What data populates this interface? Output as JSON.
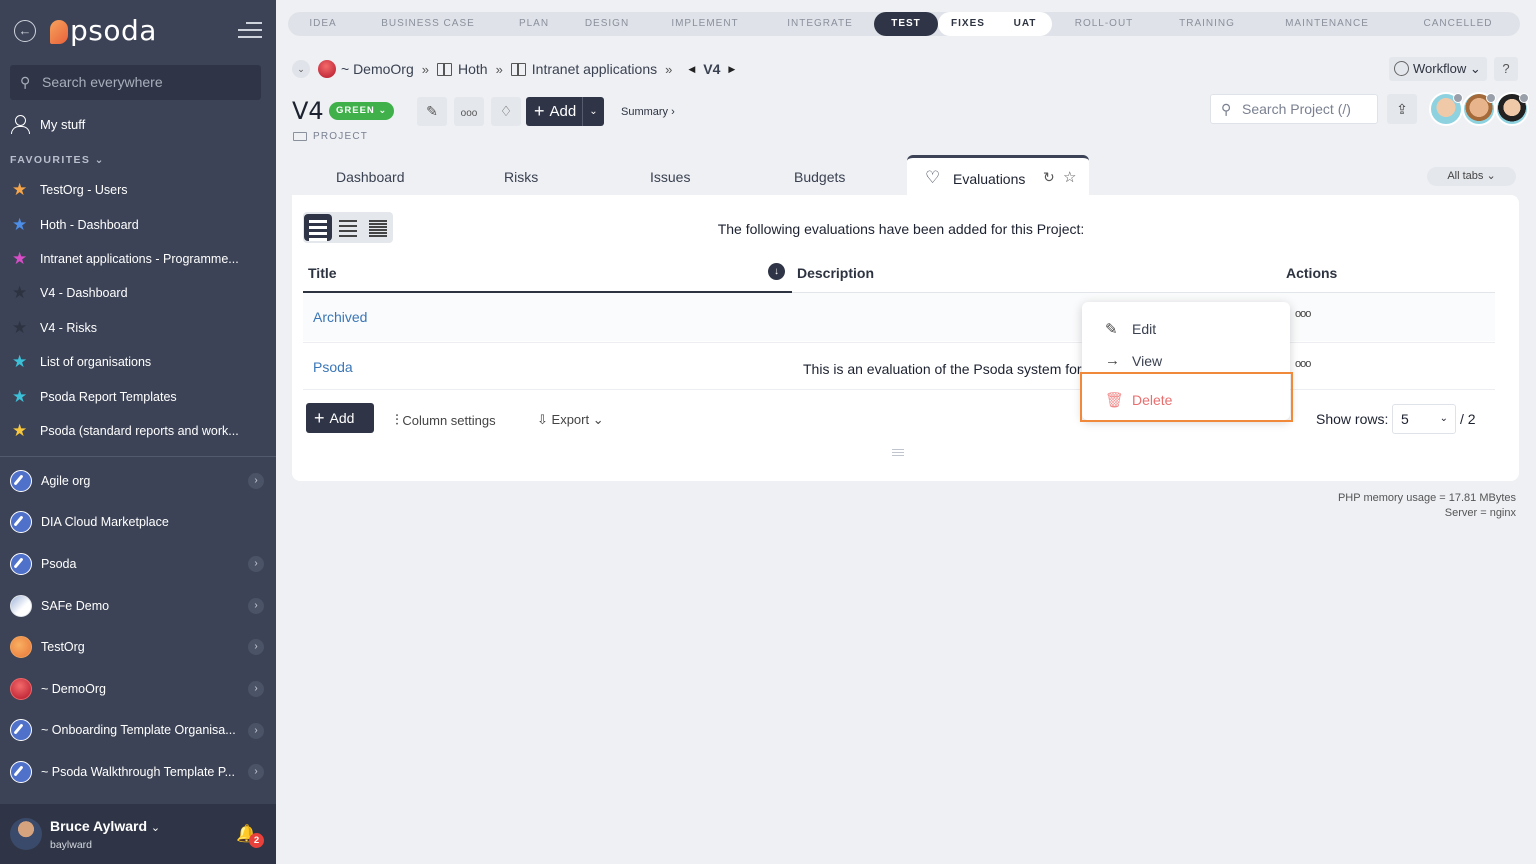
{
  "sidebar": {
    "logo_text": "psoda",
    "search_placeholder": "Search everywhere",
    "my_stuff": "My stuff",
    "favourites_label": "FAVOURITES",
    "favourites": [
      {
        "label": "TestOrg - Users",
        "color": "#f5a54a"
      },
      {
        "label": "Hoth - Dashboard",
        "color": "#4d8fe8"
      },
      {
        "label": "Intranet applications - Programme...",
        "color": "#d84ec8"
      },
      {
        "label": "V4 - Dashboard",
        "color": "#2d3340"
      },
      {
        "label": "V4 - Risks",
        "color": "#2d3340"
      },
      {
        "label": "List of organisations",
        "color": "#3cc0d8"
      },
      {
        "label": "Psoda Report Templates",
        "color": "#3cc0d8"
      },
      {
        "label": "Psoda (standard reports and work...",
        "color": "#f5c63e"
      }
    ],
    "orgs": [
      {
        "label": "Agile org",
        "icon": "compass",
        "chevron": true
      },
      {
        "label": "DIA Cloud Marketplace",
        "icon": "compass",
        "chevron": false
      },
      {
        "label": "Psoda",
        "icon": "compass",
        "chevron": true
      },
      {
        "label": "SAFe Demo",
        "icon": "safe",
        "chevron": true
      },
      {
        "label": "TestOrg",
        "icon": "test",
        "chevron": true
      },
      {
        "label": "~ DemoOrg",
        "icon": "demo",
        "chevron": true
      },
      {
        "label": "~ Onboarding Template Organisa...",
        "icon": "compass",
        "chevron": true
      },
      {
        "label": "~ Psoda Walkthrough Template P...",
        "icon": "compass",
        "chevron": true
      }
    ],
    "user": {
      "name": "Bruce Aylward",
      "handle": "baylward",
      "notifications": "2"
    }
  },
  "stages": [
    {
      "label": "IDEA",
      "w": 70,
      "state": "none"
    },
    {
      "label": "BUSINESS CASE",
      "w": 140,
      "state": "none"
    },
    {
      "label": "PLAN",
      "w": 72,
      "state": "none"
    },
    {
      "label": "DESIGN",
      "w": 74,
      "state": "none"
    },
    {
      "label": "IMPLEMENT",
      "w": 122,
      "state": "none"
    },
    {
      "label": "INTEGRATE",
      "w": 108,
      "state": "none"
    },
    {
      "label": "TEST",
      "w": 64,
      "state": "active"
    },
    {
      "label": "FIXES",
      "w": 60,
      "state": "light-first"
    },
    {
      "label": "UAT",
      "w": 54,
      "state": "light-last"
    },
    {
      "label": "ROLL-OUT",
      "w": 104,
      "state": "none"
    },
    {
      "label": "TRAINING",
      "w": 102,
      "state": "none"
    },
    {
      "label": "MAINTENANCE",
      "w": 138,
      "state": "none"
    },
    {
      "label": "CANCELLED",
      "w": 124,
      "state": "none"
    }
  ],
  "breadcrumb": {
    "org": "~ DemoOrg",
    "portfolio": "Hoth",
    "programme": "Intranet applications",
    "project": "V4",
    "sep": "»"
  },
  "header": {
    "workflow": "Workflow",
    "help": "?",
    "title": "V4",
    "status": "GREEN",
    "type": "PROJECT",
    "add": "Add",
    "summary": "Summary",
    "search_placeholder": "Search Project (/)"
  },
  "tabs": {
    "items": [
      "Dashboard",
      "Risks",
      "Issues",
      "Budgets"
    ],
    "active": "Evaluations",
    "all_tabs": "All tabs"
  },
  "panel": {
    "intro": "The following evaluations have been added for this Project:",
    "columns": {
      "title": "Title",
      "description": "Description",
      "actions": "Actions"
    },
    "rows": [
      {
        "title": "Archived",
        "description": ""
      },
      {
        "title": "Psoda",
        "description": "This is an evaluation of the Psoda system for"
      }
    ],
    "add": "Add",
    "column_settings": "Column settings",
    "export": "Export",
    "show_rows_label": "Show rows:",
    "show_rows_value": "5",
    "pages": "/ 2"
  },
  "menu": {
    "edit": "Edit",
    "view": "View",
    "delete": "Delete"
  },
  "footer": {
    "memory": "PHP memory usage = 17.81 MBytes",
    "server": "Server = nginx"
  }
}
